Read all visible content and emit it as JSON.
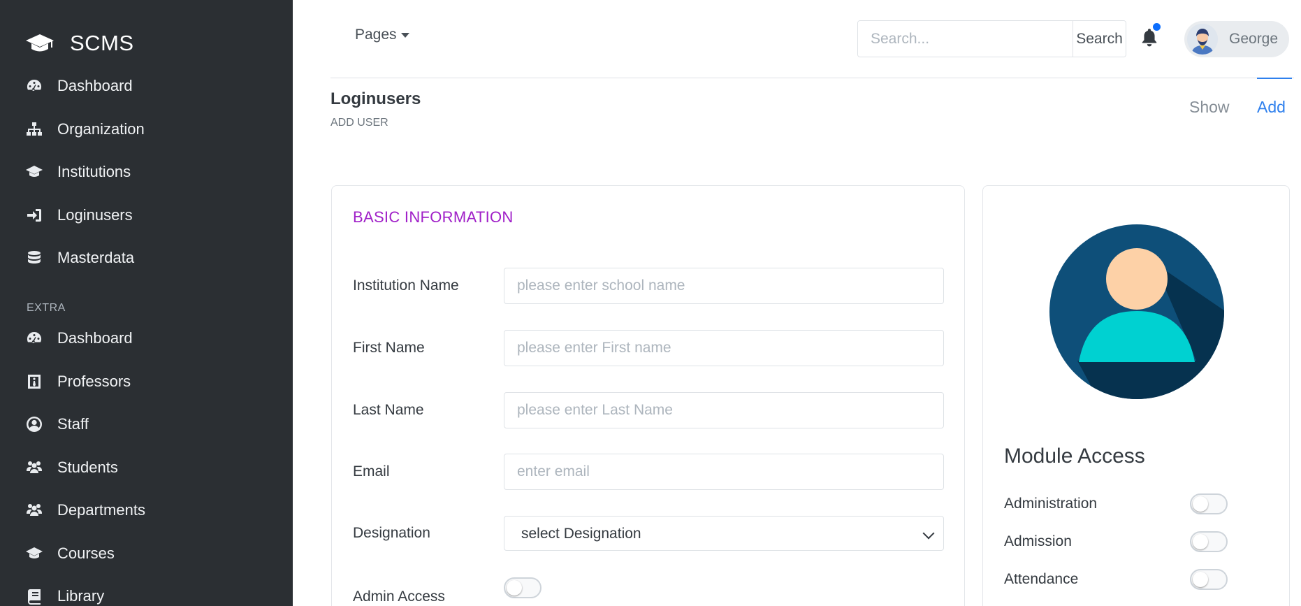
{
  "brand": {
    "name": "SCMS"
  },
  "sidebar": {
    "main_items": [
      {
        "label": "Dashboard",
        "icon": "dashboard-icon"
      },
      {
        "label": "Organization",
        "icon": "sitemap-icon"
      },
      {
        "label": "Institutions",
        "icon": "graduation-cap-icon"
      },
      {
        "label": "Loginusers",
        "icon": "sign-in-icon"
      },
      {
        "label": "Masterdata",
        "icon": "database-icon"
      }
    ],
    "extra_label": "EXTRA",
    "extra_items": [
      {
        "label": "Dashboard",
        "icon": "dashboard-icon"
      },
      {
        "label": "Professors",
        "icon": "id-badge-icon"
      },
      {
        "label": "Staff",
        "icon": "user-circle-icon"
      },
      {
        "label": "Students",
        "icon": "users-icon"
      },
      {
        "label": "Departments",
        "icon": "users-icon"
      },
      {
        "label": "Courses",
        "icon": "graduation-cap-icon"
      },
      {
        "label": "Library",
        "icon": "book-icon"
      }
    ]
  },
  "topbar": {
    "pages_label": "Pages",
    "search_placeholder": "Search...",
    "search_button": "Search",
    "user_name": "George",
    "notification_color": "#0d6efd"
  },
  "header": {
    "title": "Loginusers",
    "subtitle": "ADD USER",
    "tabs": {
      "show": "Show",
      "add": "Add"
    }
  },
  "basic_info": {
    "title": "BASIC INFORMATION",
    "fields": {
      "institution": {
        "label": "Institution Name",
        "placeholder": "please enter school name"
      },
      "first_name": {
        "label": "First Name",
        "placeholder": "please enter First name"
      },
      "last_name": {
        "label": "Last Name",
        "placeholder": "please enter Last Name"
      },
      "email": {
        "label": "Email",
        "placeholder": "enter email"
      },
      "designation": {
        "label": "Designation",
        "selected": "select Designation"
      },
      "admin_access": {
        "label": "Admin Access",
        "enabled": false
      }
    }
  },
  "module_access": {
    "title": "Module Access",
    "modules": [
      {
        "label": "Administration",
        "enabled": false
      },
      {
        "label": "Admission",
        "enabled": false
      },
      {
        "label": "Attendance",
        "enabled": false
      }
    ]
  },
  "colors": {
    "sidebar_bg": "#2b2f33",
    "accent_blue": "#2f80ed",
    "section_title": "#a020c8"
  }
}
